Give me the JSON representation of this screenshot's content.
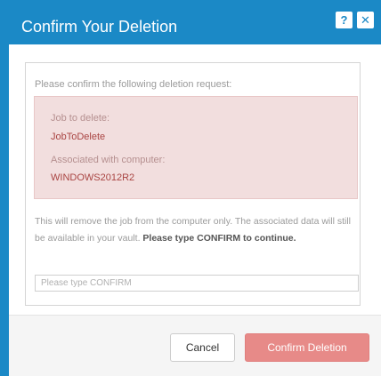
{
  "dialog": {
    "title": "Confirm Your Deletion",
    "help_label": "?",
    "close_label": "✕"
  },
  "content": {
    "intro": "Please confirm the following deletion request:",
    "job_label": "Job to delete:",
    "job_value": "JobToDelete",
    "computer_label": "Associated with computer:",
    "computer_value": "WINDOWS2012R2",
    "description": "This will remove the job from the computer only. The associated data will still be available in your vault.",
    "description_bold": "Please type CONFIRM to continue.",
    "input_placeholder": "Please type CONFIRM",
    "input_value": ""
  },
  "footer": {
    "cancel_label": "Cancel",
    "confirm_label": "Confirm Deletion"
  },
  "colors": {
    "header": "#1b89c6",
    "alert_bg": "#f2dede",
    "alert_text": "#a94442",
    "confirm_button": "#e78a88"
  },
  "icons": {
    "help": "help-icon",
    "close": "close-icon"
  }
}
